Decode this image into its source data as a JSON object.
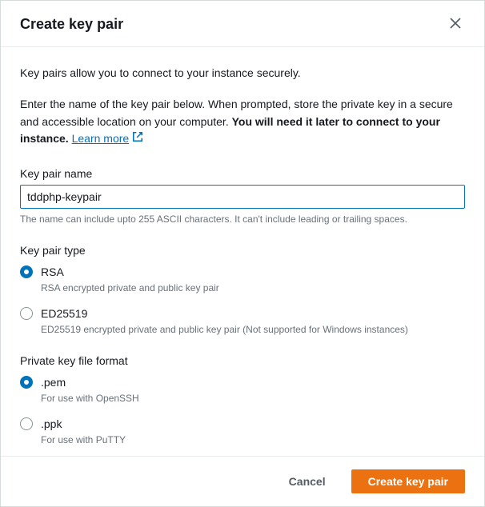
{
  "header": {
    "title": "Create key pair"
  },
  "body": {
    "intro": "Key pairs allow you to connect to your instance securely.",
    "descriptionPrefix": "Enter the name of the key pair below. When prompted, store the private key in a secure and accessible location on your computer. ",
    "descriptionBold": "You will need it later to connect to your instance.",
    "learnMore": "Learn more",
    "nameField": {
      "label": "Key pair name",
      "value": "tddphp-keypair",
      "helper": "The name can include upto 255 ASCII characters. It can't include leading or trailing spaces."
    },
    "keyType": {
      "label": "Key pair type",
      "options": [
        {
          "value": "RSA",
          "desc": "RSA encrypted private and public key pair",
          "selected": true
        },
        {
          "value": "ED25519",
          "desc": "ED25519 encrypted private and public key pair (Not supported for Windows instances)",
          "selected": false
        }
      ]
    },
    "fileFormat": {
      "label": "Private key file format",
      "options": [
        {
          "value": ".pem",
          "desc": "For use with OpenSSH",
          "selected": true
        },
        {
          "value": ".ppk",
          "desc": "For use with PuTTY",
          "selected": false
        }
      ]
    }
  },
  "footer": {
    "cancel": "Cancel",
    "submit": "Create key pair"
  }
}
